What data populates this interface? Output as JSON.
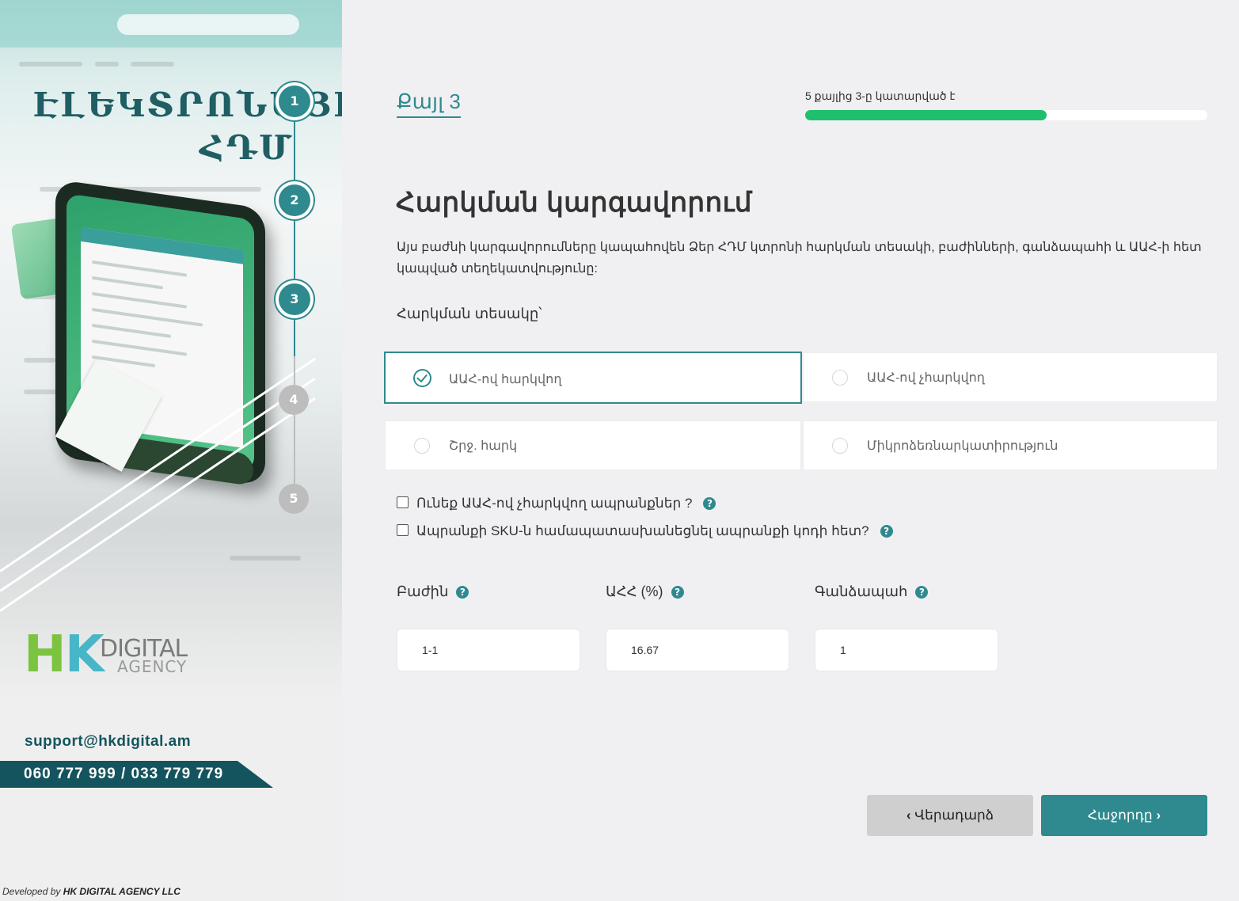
{
  "sidebar": {
    "title_line1": "ԷԼԵԿՏՐՈՆԱՅԻՆ",
    "title_line2": "ՀԴՄ",
    "steps": [
      {
        "number": "1",
        "state": "done"
      },
      {
        "number": "2",
        "state": "done"
      },
      {
        "number": "3",
        "state": "current"
      },
      {
        "number": "4",
        "state": "todo"
      },
      {
        "number": "5",
        "state": "todo"
      }
    ],
    "logo": {
      "h": "H",
      "k": "K",
      "digital": "DIGITAL",
      "agency": "AGENCY"
    },
    "support_email": "support@hkdigital.am",
    "phones": "060 777 999 / 033 779 779",
    "developed_prefix": "Developed by",
    "developed_company": "HK DIGITAL AGENCY LLC"
  },
  "header": {
    "step_label": "Քայլ 3",
    "progress_text": "5 քայլից 3-ը կատարված է",
    "progress_fraction": 0.6
  },
  "main": {
    "title": "Հարկման կարգավորում",
    "description": "Այս բաժնի կարգավորումները կապահովեն Ձեր ՀԴՄ կտրոնի հարկման տեսակի, բաժինների, գանձապահի և ԱԱՀ-ի հետ կապված տեղեկատվությունը:",
    "tax_type_label": "Հարկման տեսակը՝",
    "options": [
      {
        "label": "ԱԱՀ-ով հարկվող",
        "selected": true
      },
      {
        "label": "ԱԱՀ-ով չհարկվող",
        "selected": false
      },
      {
        "label": "Շրջ. հարկ",
        "selected": false
      },
      {
        "label": "Միկրոձեռնարկատիրություն",
        "selected": false
      }
    ],
    "checkboxes": [
      {
        "label": "Ունեք ԱԱՀ-ով չհարկվող ապրանքներ ?",
        "checked": false
      },
      {
        "label": "Ապրանքի SKU-ն համապատասխանեցնել ապրանքի կոդի հետ?",
        "checked": false
      }
    ],
    "fields": [
      {
        "label": "Բաժին",
        "value": "1-1"
      },
      {
        "label": "ԱՀՀ (%)",
        "value": "16.67"
      },
      {
        "label": "Գանձապահ",
        "value": "1"
      }
    ],
    "help_glyph": "?"
  },
  "footer": {
    "back_label": "Վերադարձ",
    "next_label": "Հաջորդը",
    "back_chevron": "‹",
    "next_chevron": "›"
  },
  "colors": {
    "accent": "#2f8a8f",
    "progress": "#1fbf6e",
    "brand_dark": "#14545e"
  }
}
